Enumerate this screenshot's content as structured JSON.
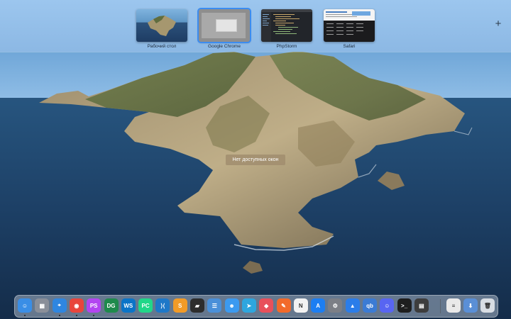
{
  "spaces": [
    {
      "label": "Рабочий стол",
      "active": false
    },
    {
      "label": "Google Chrome",
      "active": true
    },
    {
      "label": "PhpStorm",
      "active": false
    },
    {
      "label": "Safari",
      "active": false
    }
  ],
  "add_space_label": "+",
  "no_windows_text": "Нет доступных окон",
  "dock": {
    "items": [
      {
        "name": "finder-icon",
        "glyph": "☺",
        "color": "#3a8ee6",
        "running": true
      },
      {
        "name": "launchpad-icon",
        "glyph": "▦",
        "color": "#8a8f99",
        "running": false
      },
      {
        "name": "safari-icon",
        "glyph": "⌖",
        "color": "#2f86e0",
        "running": true
      },
      {
        "name": "chrome-icon",
        "glyph": "◉",
        "color": "#e8453c",
        "running": true
      },
      {
        "name": "phpstorm-icon",
        "glyph": "PS",
        "color": "#b345f1",
        "running": true
      },
      {
        "name": "datagrip-icon",
        "glyph": "DG",
        "color": "#1f8a4c",
        "running": false
      },
      {
        "name": "webstorm-icon",
        "glyph": "WS",
        "color": "#0b74c7",
        "running": false
      },
      {
        "name": "pycharm-icon",
        "glyph": "PC",
        "color": "#21d789",
        "running": false
      },
      {
        "name": "vscode-icon",
        "glyph": "⟩⟨",
        "color": "#1e78c8",
        "running": false
      },
      {
        "name": "sublime-icon",
        "glyph": "S",
        "color": "#f29b27",
        "running": false
      },
      {
        "name": "terminal-app-icon",
        "glyph": "▰",
        "color": "#2d2d2d",
        "running": false
      },
      {
        "name": "database-icon",
        "glyph": "☰",
        "color": "#4a90d9",
        "running": false
      },
      {
        "name": "finder-duplicate-icon",
        "glyph": "☻",
        "color": "#3b9af0",
        "running": false
      },
      {
        "name": "telegram-icon",
        "glyph": "➤",
        "color": "#2ea6de",
        "running": false
      },
      {
        "name": "shortcuts-icon",
        "glyph": "◆",
        "color": "#e8505b",
        "running": false
      },
      {
        "name": "pencil-app-icon",
        "glyph": "✎",
        "color": "#f26a2a",
        "running": false
      },
      {
        "name": "notion-icon",
        "glyph": "N",
        "color": "#f2f2f2",
        "running": false
      },
      {
        "name": "app-store-icon",
        "glyph": "A",
        "color": "#1c7ef2",
        "running": false
      },
      {
        "name": "system-preferences-icon",
        "glyph": "⚙",
        "color": "#7c7f86",
        "running": false
      },
      {
        "name": "testflight-icon",
        "glyph": "▲",
        "color": "#2b7de9",
        "running": false
      },
      {
        "name": "qbittorrent-icon",
        "glyph": "qb",
        "color": "#3b7bd4",
        "running": false
      },
      {
        "name": "discord-icon",
        "glyph": "☺",
        "color": "#5865f2",
        "running": false
      },
      {
        "name": "terminal-icon",
        "glyph": ">_",
        "color": "#1e1e1e",
        "running": false
      },
      {
        "name": "calculator-icon",
        "glyph": "▤",
        "color": "#3d3d3d",
        "running": false
      },
      {
        "name": "document-icon",
        "glyph": "≡",
        "color": "#e9e9e9",
        "running": false
      },
      {
        "name": "downloads-icon",
        "glyph": "⬇",
        "color": "#5a8fd6",
        "running": false
      },
      {
        "name": "trash-icon",
        "glyph": "🗑",
        "color": "#d8dde3",
        "running": false
      }
    ]
  }
}
